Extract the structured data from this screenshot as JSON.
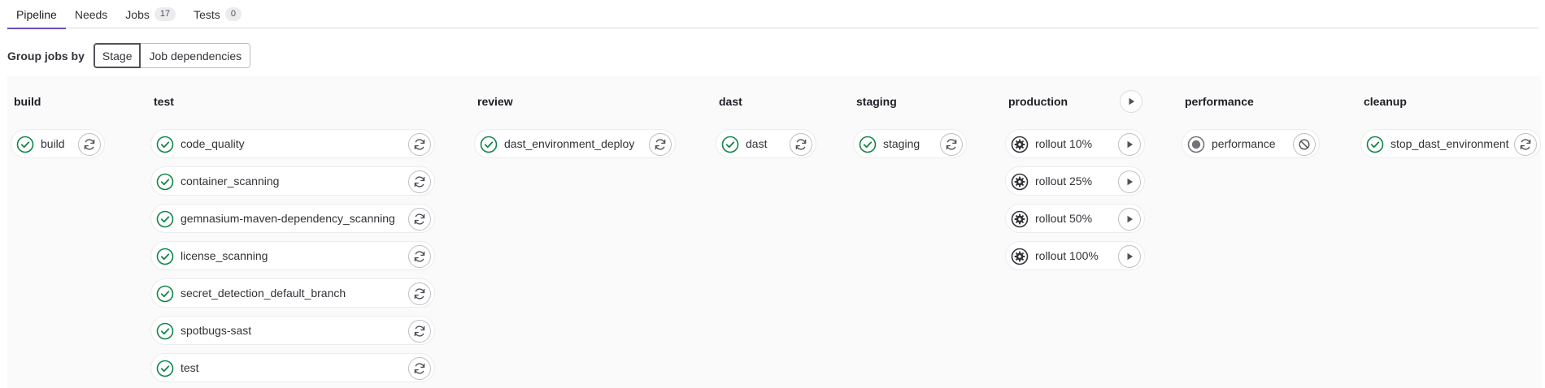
{
  "tabs": [
    {
      "label": "Pipeline",
      "active": true
    },
    {
      "label": "Needs"
    },
    {
      "label": "Jobs",
      "count": "17"
    },
    {
      "label": "Tests",
      "count": "0"
    }
  ],
  "group_by": {
    "label": "Group jobs by",
    "options": [
      "Stage",
      "Job dependencies"
    ],
    "selected": "Stage"
  },
  "colors": {
    "success": "#108548",
    "manual": "#333238",
    "skipped": "#737278",
    "active_tab": "#6b4fbb"
  },
  "stages": [
    {
      "name": "build",
      "jobs": [
        {
          "name": "build",
          "status": "success",
          "action": "retry"
        }
      ]
    },
    {
      "name": "test",
      "jobs": [
        {
          "name": "code_quality",
          "status": "success",
          "action": "retry"
        },
        {
          "name": "container_scanning",
          "status": "success",
          "action": "retry"
        },
        {
          "name": "gemnasium-maven-dependency_scanning",
          "status": "success",
          "action": "retry"
        },
        {
          "name": "license_scanning",
          "status": "success",
          "action": "retry"
        },
        {
          "name": "secret_detection_default_branch",
          "status": "success",
          "action": "retry"
        },
        {
          "name": "spotbugs-sast",
          "status": "success",
          "action": "retry"
        },
        {
          "name": "test",
          "status": "success",
          "action": "retry"
        }
      ]
    },
    {
      "name": "review",
      "jobs": [
        {
          "name": "dast_environment_deploy",
          "status": "success",
          "action": "retry"
        }
      ]
    },
    {
      "name": "dast",
      "jobs": [
        {
          "name": "dast",
          "status": "success",
          "action": "retry"
        }
      ]
    },
    {
      "name": "staging",
      "jobs": [
        {
          "name": "staging",
          "status": "success",
          "action": "retry"
        }
      ]
    },
    {
      "name": "production",
      "stage_action": "play",
      "jobs": [
        {
          "name": "rollout 10%",
          "status": "manual",
          "action": "play"
        },
        {
          "name": "rollout 25%",
          "status": "manual",
          "action": "play"
        },
        {
          "name": "rollout 50%",
          "status": "manual",
          "action": "play"
        },
        {
          "name": "rollout 100%",
          "status": "manual",
          "action": "play"
        }
      ]
    },
    {
      "name": "performance",
      "jobs": [
        {
          "name": "performance",
          "status": "skipped",
          "action": "cancel"
        }
      ]
    },
    {
      "name": "cleanup",
      "jobs": [
        {
          "name": "stop_dast_environment",
          "status": "success",
          "action": "retry"
        }
      ]
    }
  ]
}
